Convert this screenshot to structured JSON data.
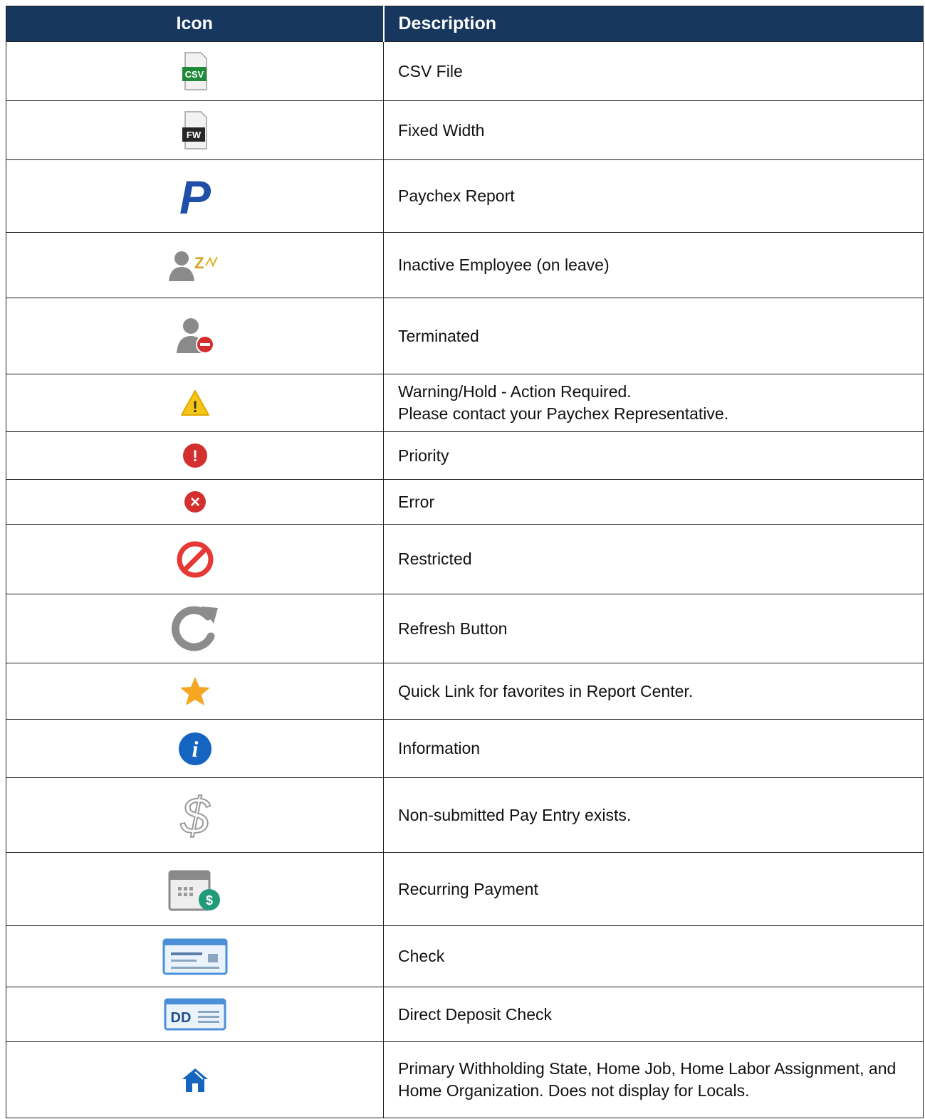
{
  "header": {
    "icon": "Icon",
    "description": "Description"
  },
  "rows": [
    {
      "icon": "csv-file-icon",
      "icon_text": "CSV",
      "description": "CSV File"
    },
    {
      "icon": "fixed-width-file-icon",
      "icon_text": "FW",
      "description": "Fixed Width"
    },
    {
      "icon": "paychex-logo-icon",
      "icon_text": "P",
      "description": "Paychex Report"
    },
    {
      "icon": "inactive-employee-icon",
      "icon_text": "Z",
      "description": "Inactive Employee (on leave)"
    },
    {
      "icon": "terminated-employee-icon",
      "description": "Terminated"
    },
    {
      "icon": "warning-triangle-icon",
      "icon_text": "!",
      "description": "Warning/Hold - Action Required.\nPlease contact your Paychex Representative."
    },
    {
      "icon": "priority-icon",
      "icon_text": "!",
      "description": "Priority"
    },
    {
      "icon": "error-icon",
      "icon_text": "×",
      "description": "Error"
    },
    {
      "icon": "restricted-icon",
      "description": "Restricted"
    },
    {
      "icon": "refresh-icon",
      "description": "Refresh Button"
    },
    {
      "icon": "star-icon",
      "description": "Quick Link for favorites in Report Center."
    },
    {
      "icon": "information-icon",
      "icon_text": "i",
      "description": "Information"
    },
    {
      "icon": "dollar-sign-icon",
      "icon_text": "$",
      "description": "Non-submitted Pay Entry exists."
    },
    {
      "icon": "recurring-payment-icon",
      "icon_text": "$",
      "description": "Recurring Payment"
    },
    {
      "icon": "check-icon",
      "description": "Check"
    },
    {
      "icon": "direct-deposit-check-icon",
      "icon_text": "DD",
      "description": "Direct Deposit Check"
    },
    {
      "icon": "home-icon",
      "description": "Primary Withholding State, Home Job, Home Labor Assignment, and Home Organization. Does not display for Locals."
    }
  ],
  "colors": {
    "header_bg": "#17375e",
    "csv_green": "#1f8b3a",
    "warning_yellow": "#f5c518",
    "error_red": "#d32f2f",
    "info_blue": "#1565c0",
    "paychex_blue": "#1f4fa8"
  }
}
